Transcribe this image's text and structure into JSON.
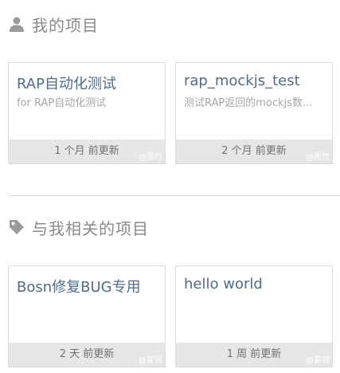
{
  "sections": {
    "mine": {
      "title": "我的项目",
      "icon": "user-icon",
      "projects": [
        {
          "name": "RAP自动化测试",
          "description": "for RAP自动化测试",
          "updated": "1 个月 前更新",
          "owner": "@思竹"
        },
        {
          "name": "rap_mockjs_test",
          "description": "测试RAP返回的mockjs数...",
          "updated": "2 个月 前更新",
          "owner": "@思竹"
        }
      ]
    },
    "related": {
      "title": "与我相关的项目",
      "icon": "tag-icon",
      "projects": [
        {
          "name": "Bosn修复BUG专用",
          "description": "",
          "updated": "2 天 前更新",
          "owner": "@霍领"
        },
        {
          "name": "hello world",
          "description": "",
          "updated": "1 周 前更新",
          "owner": "@霍领"
        }
      ]
    }
  },
  "colors": {
    "heading": "#8a8a8a",
    "project_name": "#4f6b8a",
    "footer_bg": "#e6e6e6",
    "border": "#dcdcdc"
  }
}
